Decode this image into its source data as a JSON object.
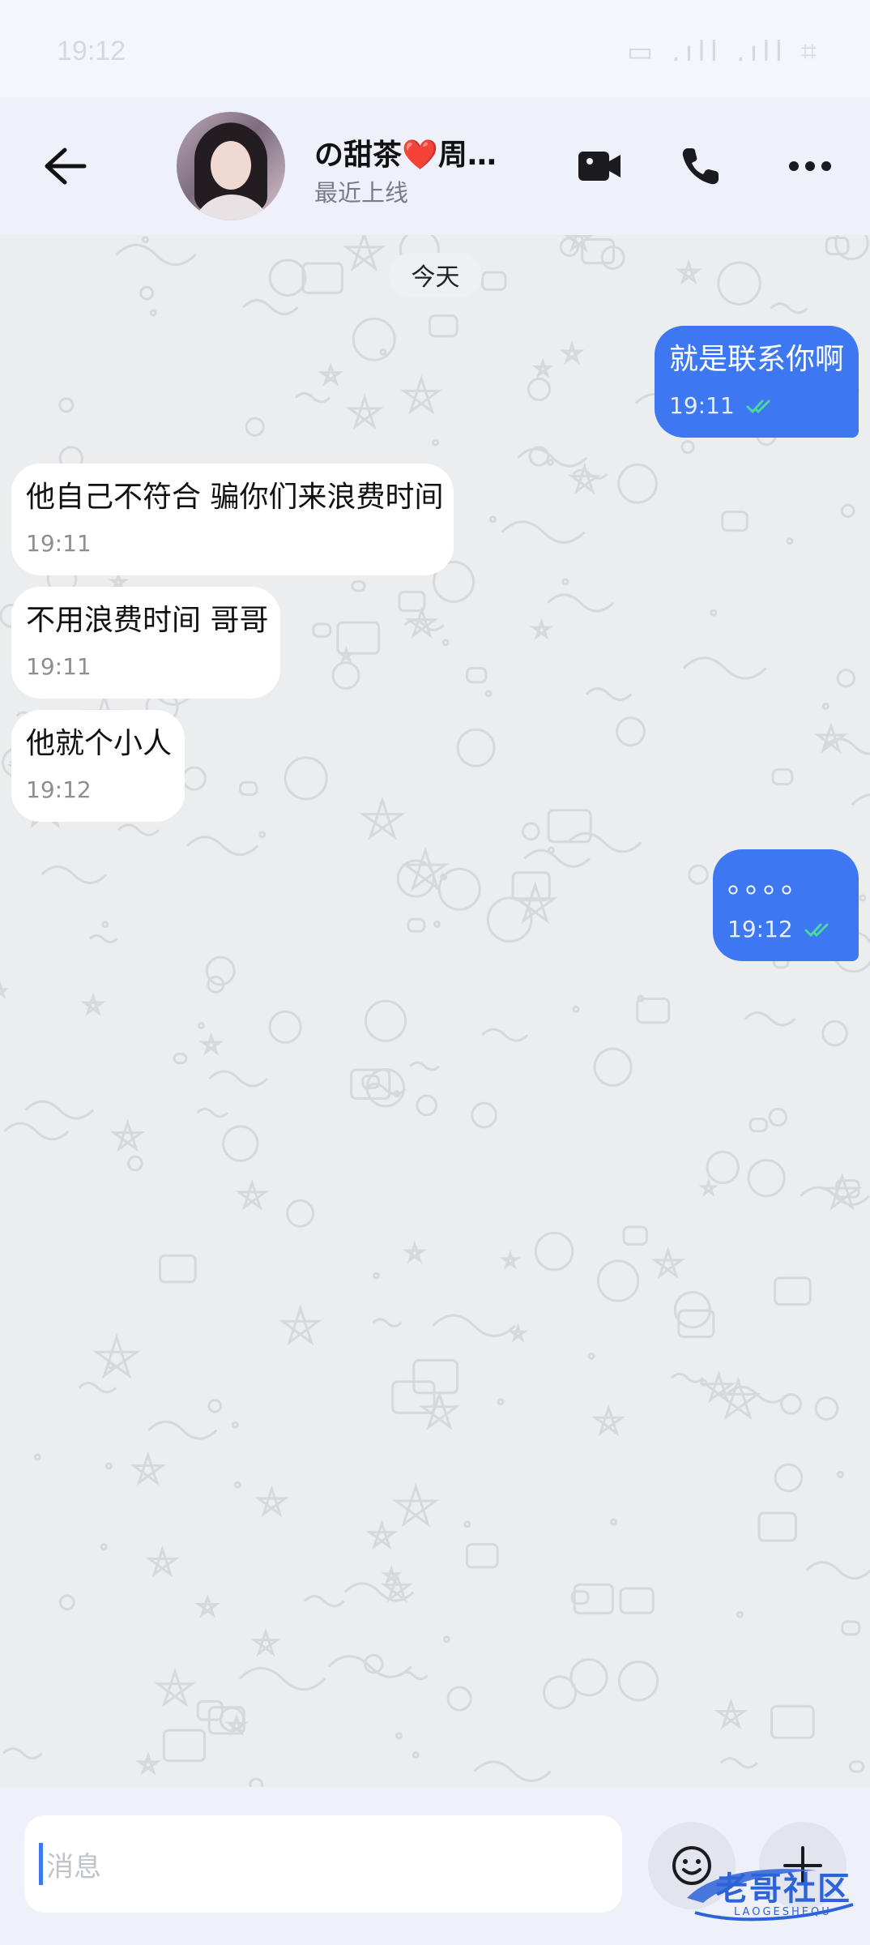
{
  "status_bar": {
    "time": "19:12",
    "right": "▭ .ıll .ıll ⌗"
  },
  "header": {
    "contact_name": "の甜茶❤️周…",
    "last_seen": "最近上线"
  },
  "chat": {
    "date_label": "今天",
    "messages": [
      {
        "direction": "out",
        "text": "就是联系你啊",
        "time": "19:11",
        "read": true
      },
      {
        "direction": "in",
        "text": "他自己不符合 骗你们来浪费时间",
        "time": "19:11"
      },
      {
        "direction": "in",
        "text": "不用浪费时间 哥哥",
        "time": "19:11"
      },
      {
        "direction": "in",
        "text": "他就个小人",
        "time": "19:12"
      },
      {
        "direction": "out",
        "text": "。。。。",
        "time": "19:12",
        "read": true
      }
    ]
  },
  "input": {
    "placeholder": "消息"
  },
  "watermark": {
    "text": "老哥社区",
    "sub": "LAOGESHEQU"
  },
  "colors": {
    "accent": "#3d78f2",
    "incoming_bubble": "#ffffff",
    "header_bg": "#eef0fa",
    "read_check": "#4cd6a0"
  }
}
